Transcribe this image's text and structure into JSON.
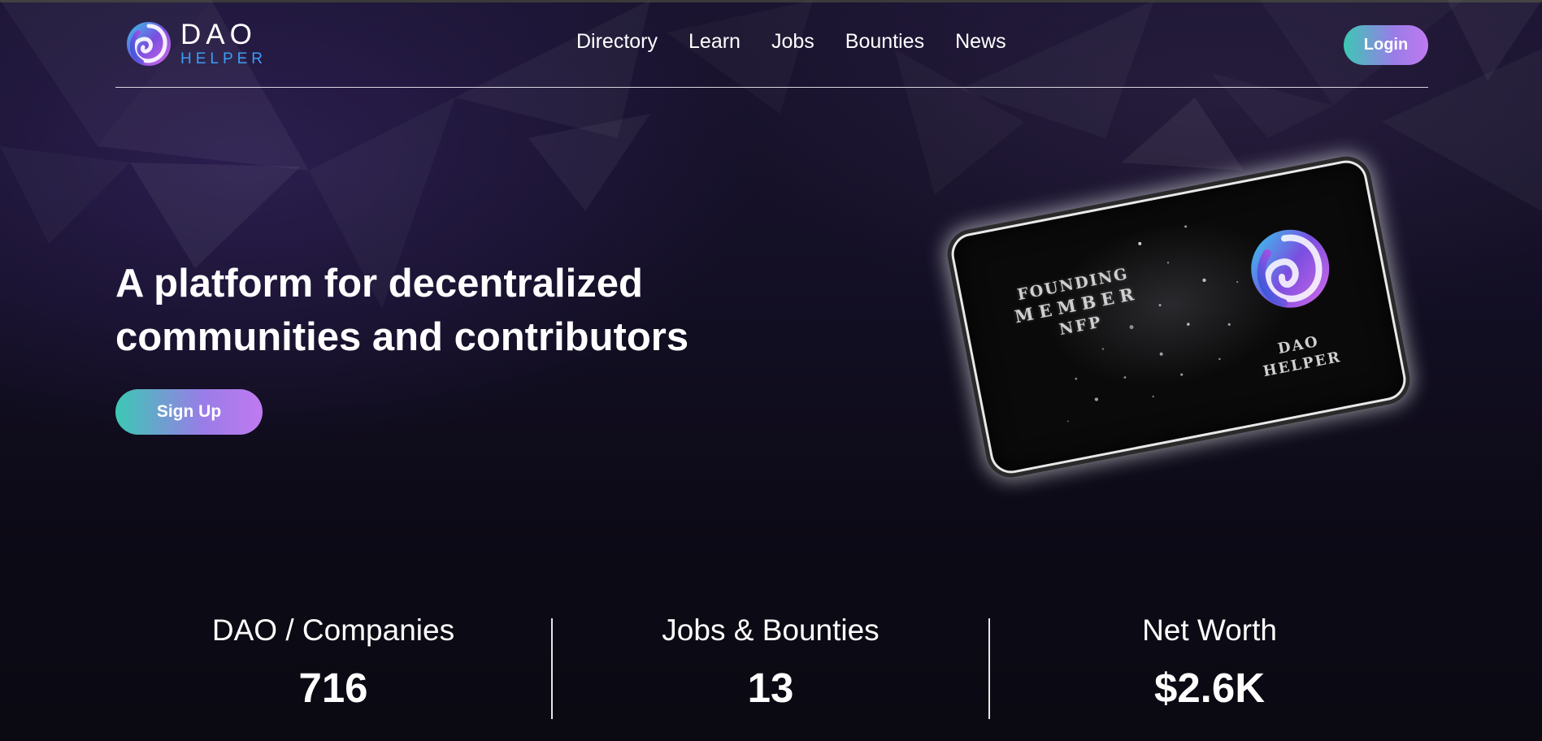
{
  "header": {
    "logo": {
      "word1": "DAO",
      "word2": "HELPER"
    },
    "nav": [
      {
        "label": "Directory"
      },
      {
        "label": "Learn"
      },
      {
        "label": "Jobs"
      },
      {
        "label": "Bounties"
      },
      {
        "label": "News"
      }
    ],
    "login_label": "Login"
  },
  "hero": {
    "title_line1": "A platform for decentralized",
    "title_line2": "communities and contributors",
    "signup_label": "Sign Up"
  },
  "nft_card": {
    "line1": "FOUNDING",
    "line2": "MEMBER",
    "line3": "NFP",
    "brand_line1": "DAO",
    "brand_line2": "HELPER"
  },
  "stats": [
    {
      "label": "DAO / Companies",
      "value": "716"
    },
    {
      "label": "Jobs & Bounties",
      "value": "13"
    },
    {
      "label": "Net Worth",
      "value": "$2.6K"
    }
  ],
  "colors": {
    "accent_teal": "#3cc8b4",
    "accent_violet": "#c07af0",
    "logo_blue": "#3d9df5",
    "background": "#0d0a16"
  }
}
